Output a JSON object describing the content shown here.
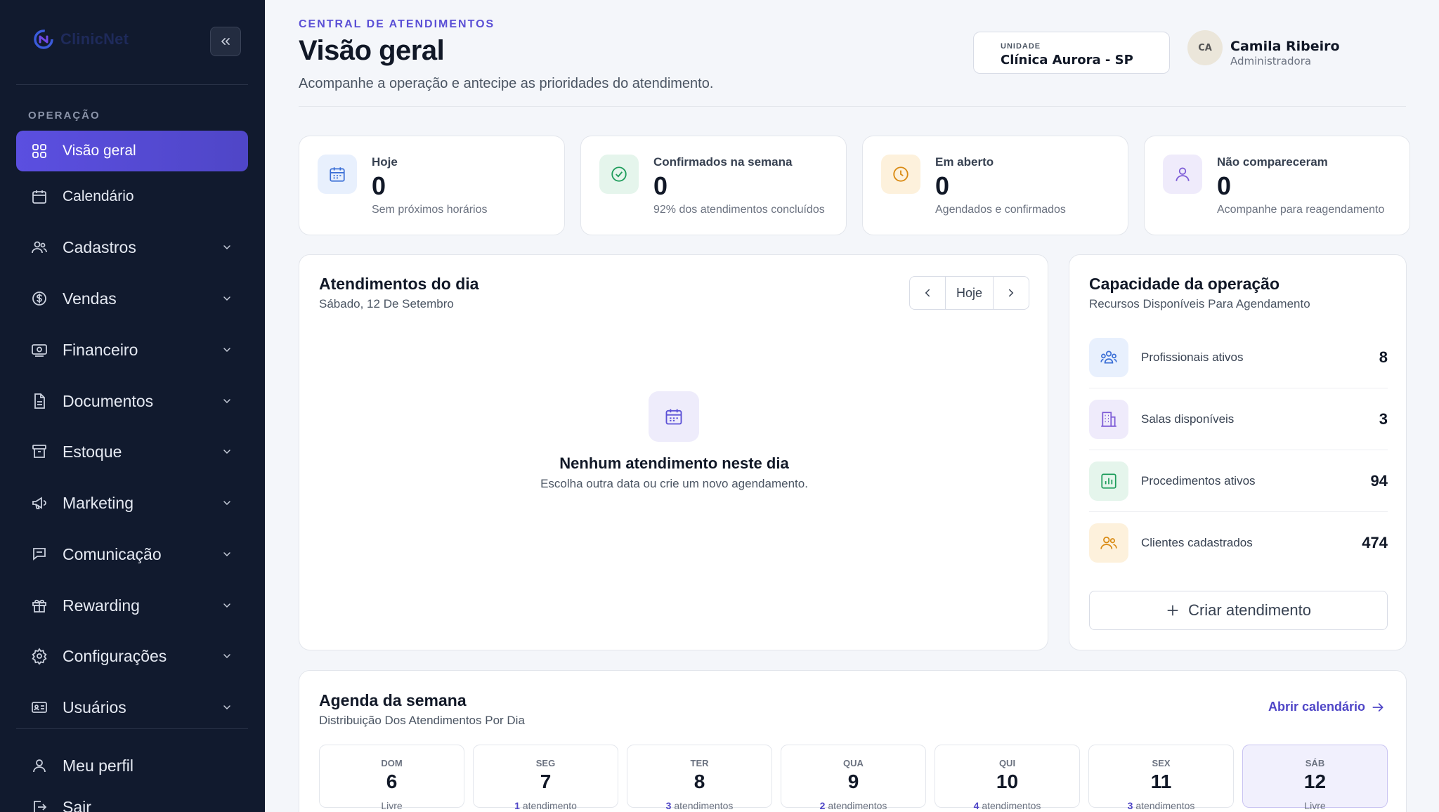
{
  "sidebar": {
    "brand": "ClinicNet",
    "section_label": "OPERAÇÃO",
    "items": [
      {
        "label": "Visão geral",
        "icon": "grid-icon",
        "active": true
      },
      {
        "label": "Calendário",
        "icon": "calendar-icon"
      },
      {
        "label": "Cadastros",
        "icon": "users-icon"
      },
      {
        "label": "Vendas",
        "icon": "dollar-icon"
      },
      {
        "label": "Financeiro",
        "icon": "banknote-icon"
      },
      {
        "label": "Documentos",
        "icon": "document-icon"
      },
      {
        "label": "Estoque",
        "icon": "archive-icon"
      },
      {
        "label": "Marketing",
        "icon": "megaphone-icon"
      },
      {
        "label": "Comunicação",
        "icon": "chat-icon"
      },
      {
        "label": "Rewarding",
        "icon": "gift-icon"
      },
      {
        "label": "Configurações",
        "icon": "gear-icon"
      },
      {
        "label": "Usuários",
        "icon": "id-card-icon"
      }
    ],
    "profile_label": "Meu perfil",
    "logout_label": "Sair"
  },
  "header": {
    "eyebrow": "CENTRAL DE ATENDIMENTOS",
    "title": "Visão geral",
    "subtitle": "Acompanhe a operação e antecipe as prioridades do atendimento.",
    "unit_label": "UNIDADE",
    "unit_value": "Clínica Aurora - SP",
    "user_initials": "CA",
    "user_name": "Camila Ribeiro",
    "user_role": "Administradora"
  },
  "stats": [
    {
      "label": "Hoje",
      "value": "0",
      "desc": "Sem próximos horários"
    },
    {
      "label": "Confirmados na semana",
      "value": "0",
      "desc": "92% dos atendimentos concluídos"
    },
    {
      "label": "Em aberto",
      "value": "0",
      "desc": "Agendados e confirmados"
    },
    {
      "label": "Não compareceram",
      "value": "0",
      "desc": "Acompanhe para reagendamento"
    }
  ],
  "day_panel": {
    "title": "Atendimentos do dia",
    "date": "Sábado, 12 De Setembro",
    "today_label": "Hoje",
    "empty_title": "Nenhum atendimento neste dia",
    "empty_sub": "Escolha outra data ou crie um novo agendamento."
  },
  "capacity": {
    "title": "Capacidade da operação",
    "subtitle": "Recursos Disponíveis Para Agendamento",
    "rows": [
      {
        "label": "Profissionais ativos",
        "value": "8"
      },
      {
        "label": "Salas disponíveis",
        "value": "3"
      },
      {
        "label": "Procedimentos ativos",
        "value": "94"
      },
      {
        "label": "Clientes cadastrados",
        "value": "474"
      }
    ],
    "create_label": "Criar atendimento"
  },
  "week": {
    "title": "Agenda da semana",
    "subtitle": "Distribuição Dos Atendimentos Por Dia",
    "open_calendar": "Abrir calendário",
    "days": [
      {
        "abbr": "DOM",
        "num": "6",
        "count": "",
        "text": "Livre"
      },
      {
        "abbr": "SEG",
        "num": "7",
        "count": "1",
        "text": "atendimento"
      },
      {
        "abbr": "TER",
        "num": "8",
        "count": "3",
        "text": "atendimentos"
      },
      {
        "abbr": "QUA",
        "num": "9",
        "count": "2",
        "text": "atendimentos"
      },
      {
        "abbr": "QUI",
        "num": "10",
        "count": "4",
        "text": "atendimentos"
      },
      {
        "abbr": "SEX",
        "num": "11",
        "count": "3",
        "text": "atendimentos"
      },
      {
        "abbr": "SÁB",
        "num": "12",
        "count": "",
        "text": "Livre",
        "selected": true
      }
    ]
  },
  "colors": {
    "sidebar_bg": "#111a2e",
    "accent": "#5b50d6",
    "page_bg": "#f4f6fa"
  }
}
